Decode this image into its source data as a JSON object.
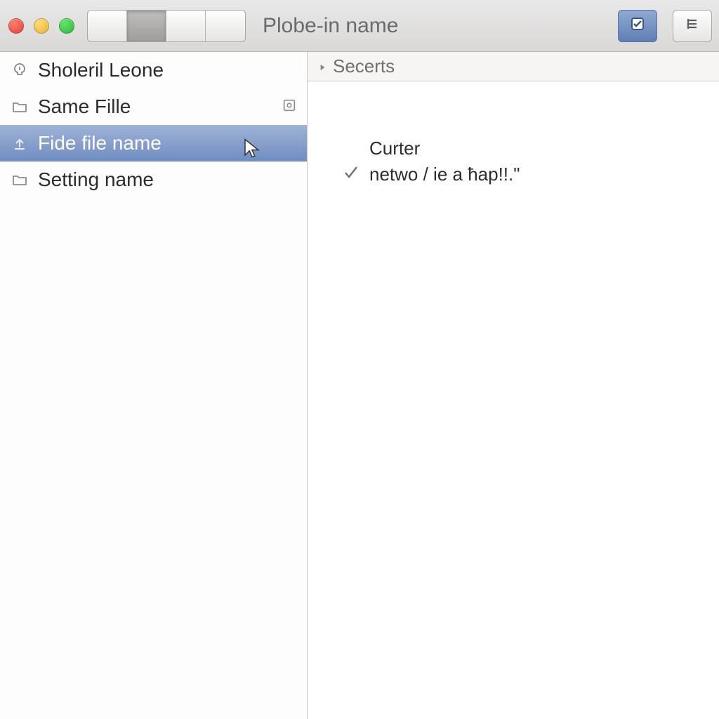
{
  "toolbar": {
    "title": "Plobe-in name"
  },
  "sidebar": {
    "items": [
      {
        "label": "Sholeril Leone",
        "icon": "pointer-icon"
      },
      {
        "label": "Same Fille",
        "icon": "folder-icon",
        "trail": "preview-icon"
      },
      {
        "label": "Fide file name",
        "icon": "upload-icon",
        "selected": true
      },
      {
        "label": "Setting name",
        "icon": "folder-icon"
      }
    ]
  },
  "content": {
    "section_header": "Secerts",
    "title": "Curter",
    "line": "netwo / ie a ħap!!.\""
  }
}
